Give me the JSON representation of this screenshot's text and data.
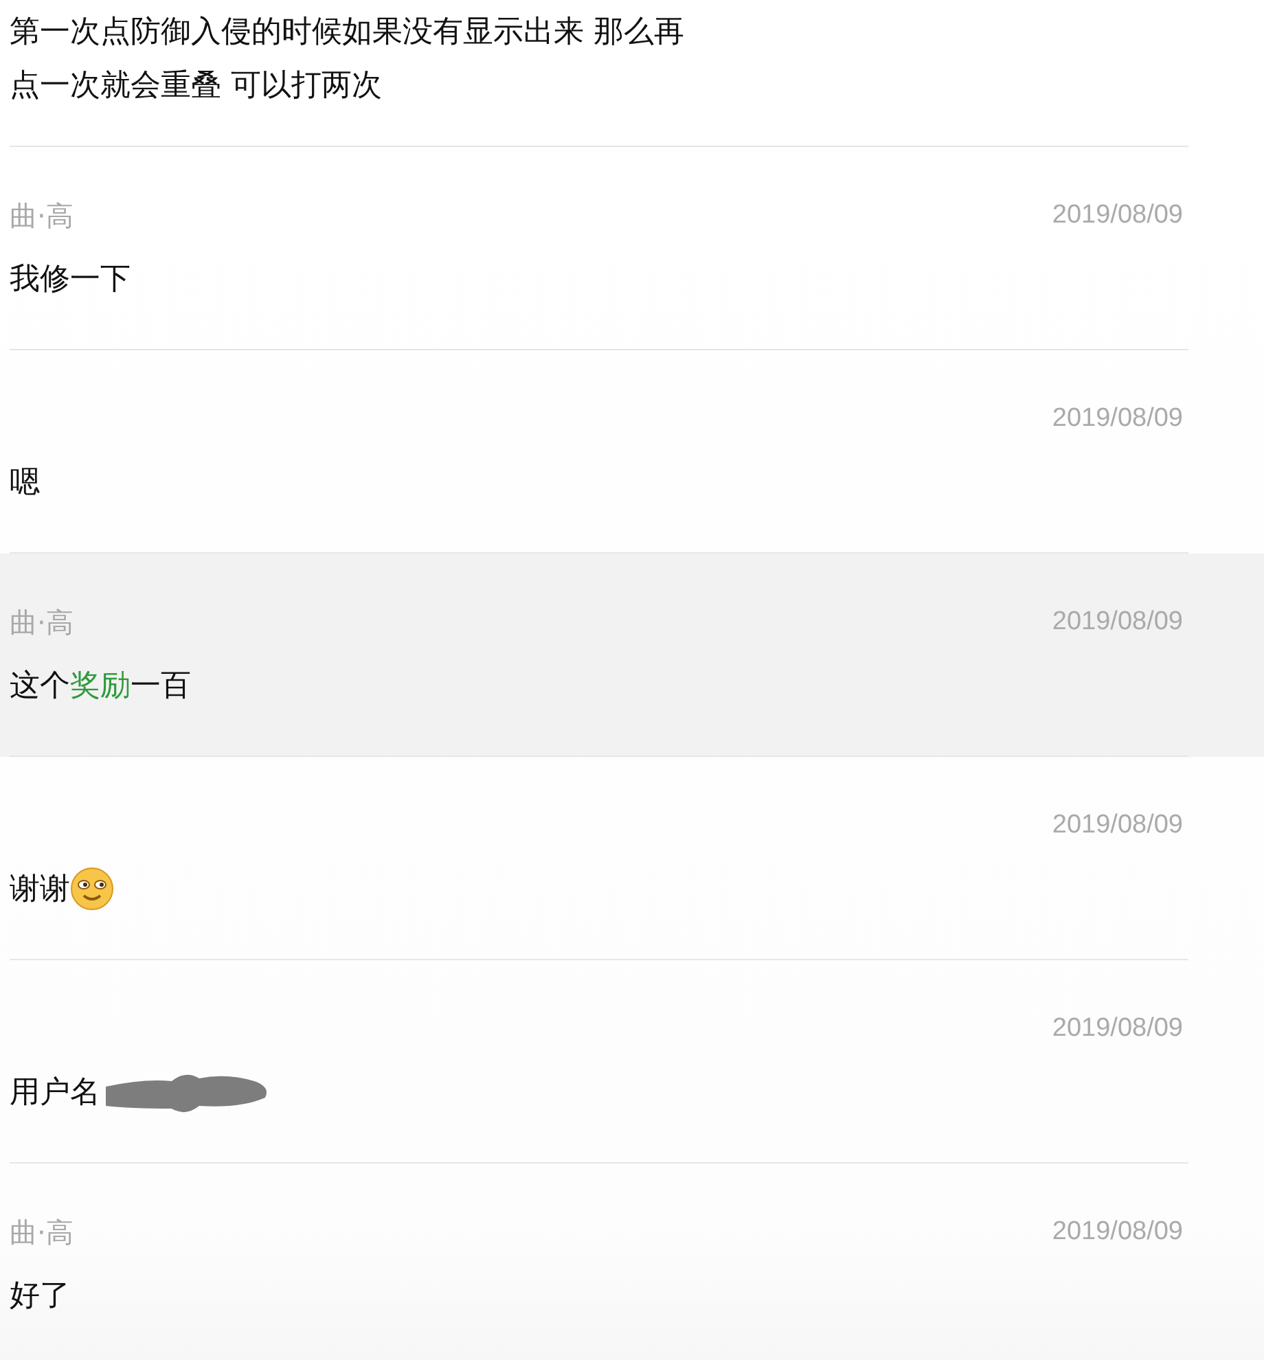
{
  "top_message": {
    "lines": [
      "第一次点防御入侵的时候如果没有显示出来 那么再",
      "点一次就会重叠 可以打两次"
    ]
  },
  "messages": [
    {
      "sender": "曲·高",
      "date": "2019/08/09",
      "selected": false,
      "parts": [
        {
          "kind": "text",
          "text": "我修一下"
        }
      ]
    },
    {
      "date": "2019/08/09",
      "selected": false,
      "parts": [
        {
          "kind": "text",
          "text": "嗯"
        }
      ]
    },
    {
      "sender": "曲·高",
      "date": "2019/08/09",
      "selected": true,
      "parts": [
        {
          "kind": "text",
          "text": "这个"
        },
        {
          "kind": "link",
          "text": "奖励"
        },
        {
          "kind": "text",
          "text": "一百"
        }
      ]
    },
    {
      "date": "2019/08/09",
      "selected": false,
      "parts": [
        {
          "kind": "text",
          "text": "谢谢"
        },
        {
          "kind": "emoji"
        }
      ]
    },
    {
      "date": "2019/08/09",
      "selected": false,
      "parts": [
        {
          "kind": "text",
          "text": "用户名"
        },
        {
          "kind": "redacted"
        }
      ]
    },
    {
      "sender": "曲·高",
      "date": "2019/08/09",
      "selected": false,
      "parts": [
        {
          "kind": "text",
          "text": "好了"
        }
      ]
    }
  ]
}
